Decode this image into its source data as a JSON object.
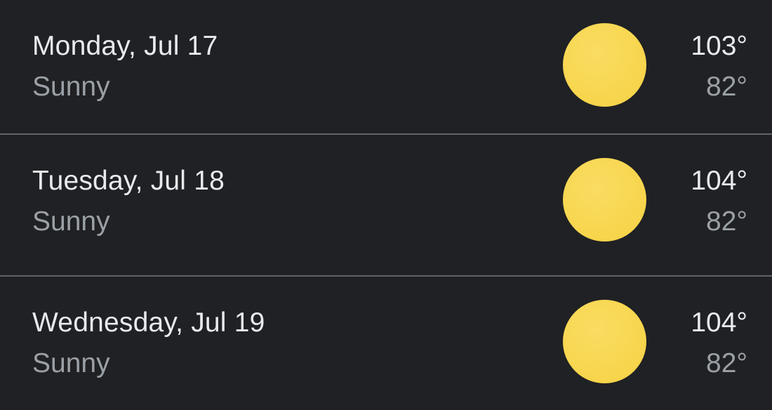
{
  "forecast": {
    "days": [
      {
        "date": "Monday, Jul 17",
        "condition": "Sunny",
        "icon": "sun-icon",
        "high": "103°",
        "low": "82°"
      },
      {
        "date": "Tuesday, Jul 18",
        "condition": "Sunny",
        "icon": "sun-icon",
        "high": "104°",
        "low": "82°"
      },
      {
        "date": "Wednesday, Jul 19",
        "condition": "Sunny",
        "icon": "sun-icon",
        "high": "104°",
        "low": "82°"
      }
    ]
  },
  "colors": {
    "background": "#202124",
    "divider": "#5f6368",
    "primary_text": "#e8eaed",
    "secondary_text": "#9aa0a6",
    "sun": "#f7d54c"
  }
}
